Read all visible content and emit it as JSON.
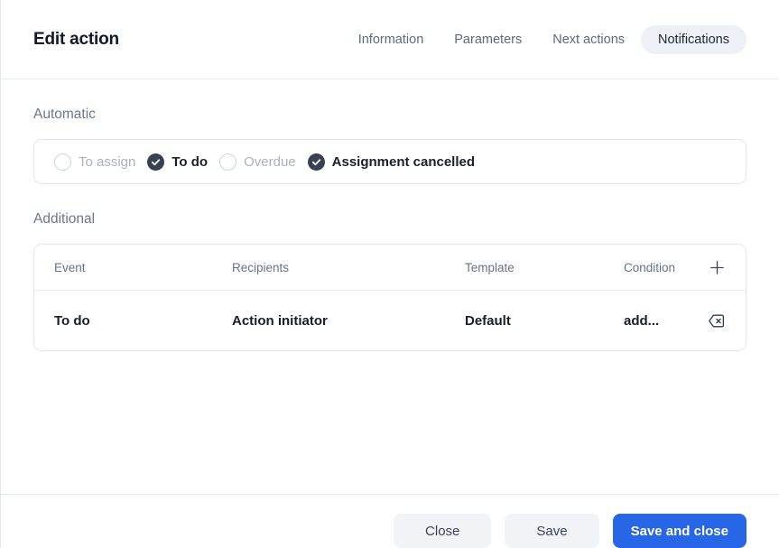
{
  "dialog": {
    "title": "Edit action"
  },
  "tabs": [
    {
      "label": "Information",
      "active": false
    },
    {
      "label": "Parameters",
      "active": false
    },
    {
      "label": "Next actions",
      "active": false
    },
    {
      "label": "Notifications",
      "active": true
    }
  ],
  "automatic": {
    "heading": "Automatic",
    "options": [
      {
        "label": "To assign",
        "checked": false
      },
      {
        "label": "To do",
        "checked": true
      },
      {
        "label": "Overdue",
        "checked": false
      },
      {
        "label": "Assignment cancelled",
        "checked": true
      }
    ]
  },
  "additional": {
    "heading": "Additional",
    "columns": {
      "event": "Event",
      "recipients": "Recipients",
      "template": "Template",
      "condition": "Condition"
    },
    "rows": [
      {
        "event": "To do",
        "recipients": "Action initiator",
        "template": "Default",
        "condition": "add..."
      }
    ],
    "icons": {
      "add_row": "plus-icon",
      "delete_row": "backspace-icon"
    }
  },
  "footer": {
    "close_label": "Close",
    "save_label": "Save",
    "save_and_close_label": "Save and close"
  },
  "icons": {
    "checked_option": "check-icon"
  },
  "colors": {
    "primary_button": "#2766e6",
    "checked_checkbox": "#364152",
    "active_tab_bg": "#edf0f4",
    "divider": "#e6ebf2",
    "muted_text": "#68788d"
  }
}
